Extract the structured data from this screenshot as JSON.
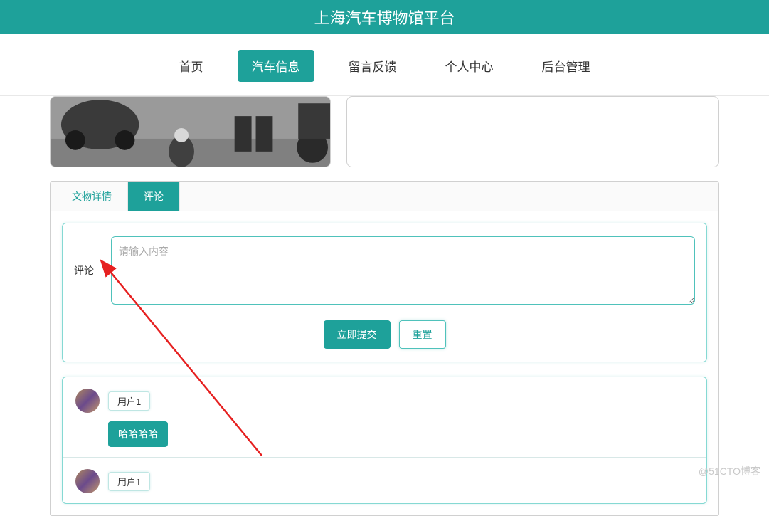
{
  "header": {
    "title": "上海汽车博物馆平台"
  },
  "nav": {
    "items": [
      {
        "label": "首页",
        "active": false
      },
      {
        "label": "汽车信息",
        "active": true
      },
      {
        "label": "留言反馈",
        "active": false
      },
      {
        "label": "个人中心",
        "active": false
      },
      {
        "label": "后台管理",
        "active": false
      }
    ]
  },
  "tabs": {
    "items": [
      {
        "label": "文物详情",
        "active": false
      },
      {
        "label": "评论",
        "active": true
      }
    ]
  },
  "form": {
    "label": "评论",
    "placeholder": "请输入内容",
    "submit_label": "立即提交",
    "reset_label": "重置"
  },
  "comments": [
    {
      "user": "用户1",
      "text": "哈哈哈哈"
    },
    {
      "user": "用户1",
      "text": ""
    }
  ],
  "watermark": "@51CTO博客"
}
